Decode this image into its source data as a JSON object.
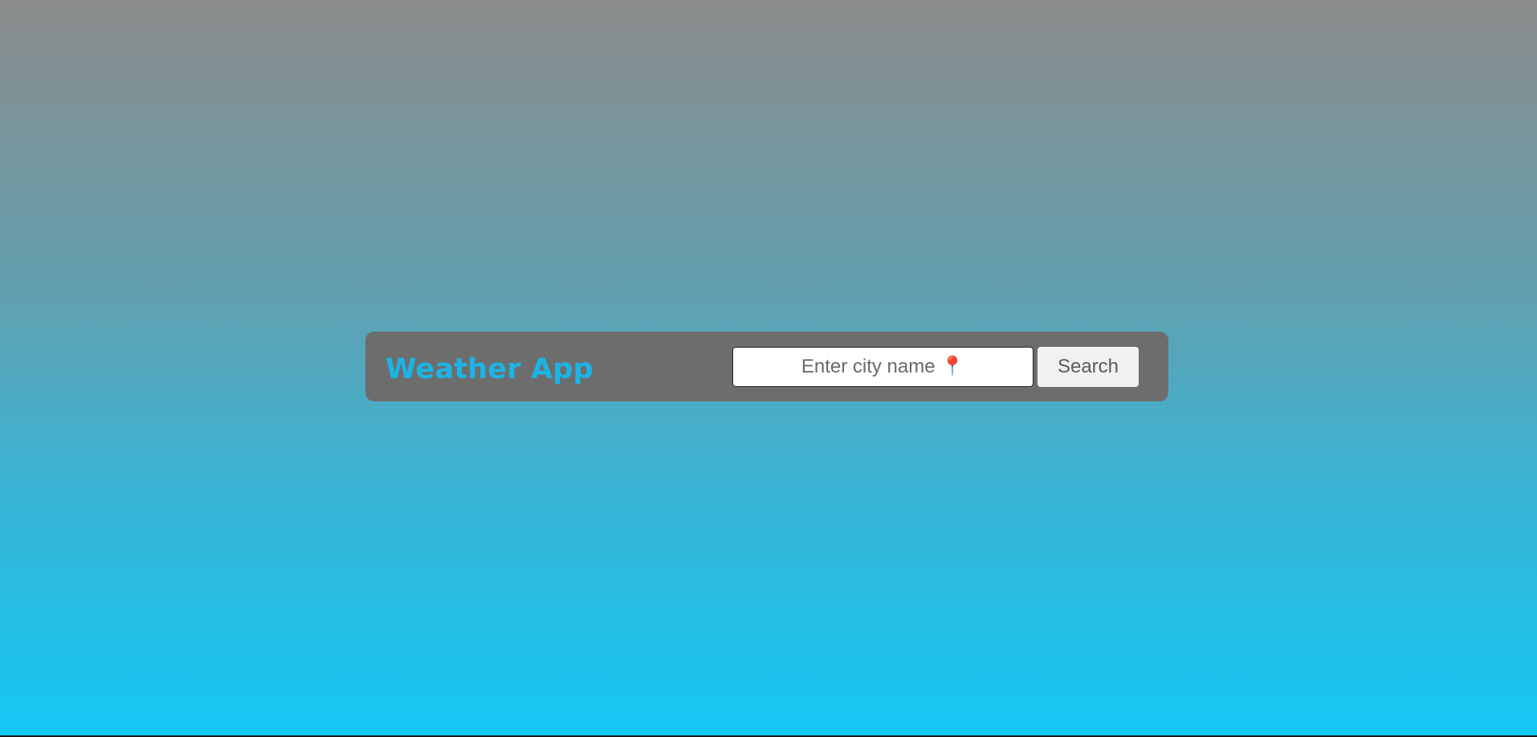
{
  "app": {
    "title": "Weather App",
    "title_color": "#1ab5e6"
  },
  "search": {
    "placeholder": "Enter city name 📍",
    "value": "",
    "button_label": "Search"
  },
  "colors": {
    "panel_background": "#6e6d6e",
    "background_top": "#8c8c8c",
    "background_bottom": "#14c8f4",
    "button_background": "#f1f1f1",
    "pin_accent": "#e6007e"
  }
}
